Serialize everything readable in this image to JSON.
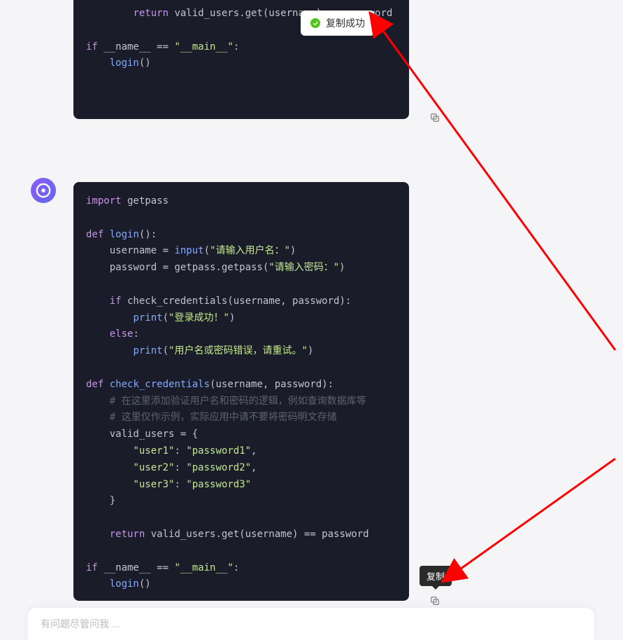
{
  "notification": {
    "text": "复制成功"
  },
  "tooltip": {
    "text": "复制"
  },
  "avatar": {
    "label": "ai"
  },
  "input": {
    "placeholder": "有问题尽管问我 ..."
  },
  "code_block_1": {
    "lines": [
      {
        "indent": 2,
        "tokens": [
          {
            "t": "return",
            "c": "kw"
          },
          {
            "t": " valid_users.get(username) == password",
            "c": ""
          }
        ]
      },
      {
        "indent": 0,
        "tokens": []
      },
      {
        "indent": 0,
        "tokens": [
          {
            "t": "if",
            "c": "kw"
          },
          {
            "t": " __name__ == ",
            "c": ""
          },
          {
            "t": "\"__main__\"",
            "c": "str"
          },
          {
            "t": ":",
            "c": ""
          }
        ]
      },
      {
        "indent": 1,
        "tokens": [
          {
            "t": "login",
            "c": "fn"
          },
          {
            "t": "()",
            "c": ""
          }
        ]
      }
    ]
  },
  "code_block_2": {
    "lines": [
      {
        "indent": 0,
        "tokens": [
          {
            "t": "import",
            "c": "kw"
          },
          {
            "t": " getpass",
            "c": ""
          }
        ]
      },
      {
        "indent": 0,
        "tokens": []
      },
      {
        "indent": 0,
        "tokens": [
          {
            "t": "def",
            "c": "kw"
          },
          {
            "t": " ",
            "c": ""
          },
          {
            "t": "login",
            "c": "fn"
          },
          {
            "t": "():",
            "c": ""
          }
        ]
      },
      {
        "indent": 1,
        "tokens": [
          {
            "t": "username = ",
            "c": ""
          },
          {
            "t": "input",
            "c": "fn"
          },
          {
            "t": "(",
            "c": ""
          },
          {
            "t": "\"请输入用户名：\"",
            "c": "str"
          },
          {
            "t": ")",
            "c": ""
          }
        ]
      },
      {
        "indent": 1,
        "tokens": [
          {
            "t": "password = getpass.getpass(",
            "c": ""
          },
          {
            "t": "\"请输入密码：\"",
            "c": "str"
          },
          {
            "t": ")",
            "c": ""
          }
        ]
      },
      {
        "indent": 0,
        "tokens": []
      },
      {
        "indent": 1,
        "tokens": [
          {
            "t": "if",
            "c": "kw"
          },
          {
            "t": " check_credentials(username, password):",
            "c": ""
          }
        ]
      },
      {
        "indent": 2,
        "tokens": [
          {
            "t": "print",
            "c": "fn"
          },
          {
            "t": "(",
            "c": ""
          },
          {
            "t": "\"登录成功！\"",
            "c": "str"
          },
          {
            "t": ")",
            "c": ""
          }
        ]
      },
      {
        "indent": 1,
        "tokens": [
          {
            "t": "else",
            "c": "kw"
          },
          {
            "t": ":",
            "c": ""
          }
        ]
      },
      {
        "indent": 2,
        "tokens": [
          {
            "t": "print",
            "c": "fn"
          },
          {
            "t": "(",
            "c": ""
          },
          {
            "t": "\"用户名或密码错误，请重试。\"",
            "c": "str"
          },
          {
            "t": ")",
            "c": ""
          }
        ]
      },
      {
        "indent": 0,
        "tokens": []
      },
      {
        "indent": 0,
        "tokens": [
          {
            "t": "def",
            "c": "kw"
          },
          {
            "t": " ",
            "c": ""
          },
          {
            "t": "check_credentials",
            "c": "fn"
          },
          {
            "t": "(username, password):",
            "c": ""
          }
        ]
      },
      {
        "indent": 1,
        "tokens": [
          {
            "t": "# 在这里添加验证用户名和密码的逻辑，例如查询数据库等",
            "c": "cm"
          }
        ]
      },
      {
        "indent": 1,
        "tokens": [
          {
            "t": "# 这里仅作示例，实际应用中请不要将密码明文存储",
            "c": "cm"
          }
        ]
      },
      {
        "indent": 1,
        "tokens": [
          {
            "t": "valid_users = {",
            "c": ""
          }
        ]
      },
      {
        "indent": 2,
        "tokens": [
          {
            "t": "\"user1\"",
            "c": "str"
          },
          {
            "t": ": ",
            "c": ""
          },
          {
            "t": "\"password1\"",
            "c": "str"
          },
          {
            "t": ",",
            "c": ""
          }
        ]
      },
      {
        "indent": 2,
        "tokens": [
          {
            "t": "\"user2\"",
            "c": "str"
          },
          {
            "t": ": ",
            "c": ""
          },
          {
            "t": "\"password2\"",
            "c": "str"
          },
          {
            "t": ",",
            "c": ""
          }
        ]
      },
      {
        "indent": 2,
        "tokens": [
          {
            "t": "\"user3\"",
            "c": "str"
          },
          {
            "t": ": ",
            "c": ""
          },
          {
            "t": "\"password3\"",
            "c": "str"
          }
        ]
      },
      {
        "indent": 1,
        "tokens": [
          {
            "t": "}",
            "c": ""
          }
        ]
      },
      {
        "indent": 0,
        "tokens": []
      },
      {
        "indent": 1,
        "tokens": [
          {
            "t": "return",
            "c": "kw"
          },
          {
            "t": " valid_users.get(username) == password",
            "c": ""
          }
        ]
      },
      {
        "indent": 0,
        "tokens": []
      },
      {
        "indent": 0,
        "tokens": [
          {
            "t": "if",
            "c": "kw"
          },
          {
            "t": " __name__ == ",
            "c": ""
          },
          {
            "t": "\"__main__\"",
            "c": "str"
          },
          {
            "t": ":",
            "c": ""
          }
        ]
      },
      {
        "indent": 1,
        "tokens": [
          {
            "t": "login",
            "c": "fn"
          },
          {
            "t": "()",
            "c": ""
          }
        ]
      }
    ]
  }
}
